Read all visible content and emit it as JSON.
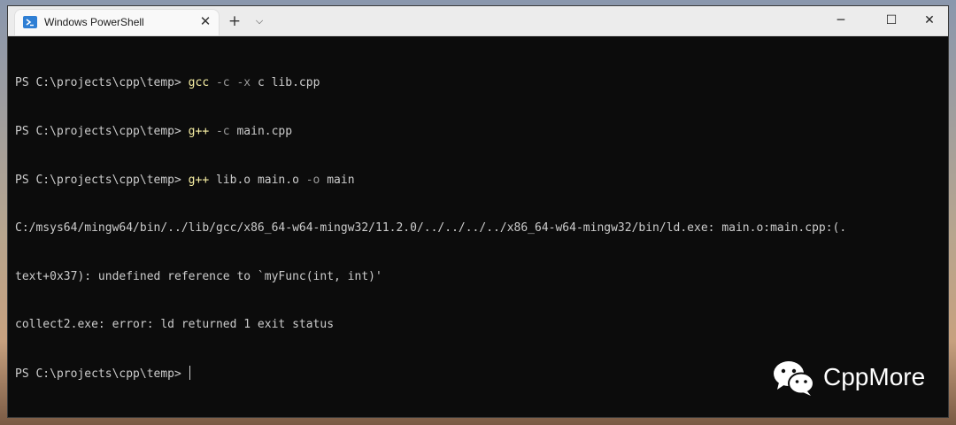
{
  "window": {
    "tab_title": "Windows PowerShell",
    "tab_close": "✕",
    "new_tab": "+",
    "dropdown": "⌵",
    "minimize": "─",
    "maximize": "☐",
    "close": "✕"
  },
  "terminal": {
    "line1": {
      "prompt": "PS C:\\projects\\cpp\\temp> ",
      "cmd": "gcc",
      "flags": " -c -x",
      "rest": " c lib.cpp"
    },
    "line2": {
      "prompt": "PS C:\\projects\\cpp\\temp> ",
      "cmd": "g++",
      "flags": " -c",
      "rest": " main.cpp"
    },
    "line3": {
      "prompt": "PS C:\\projects\\cpp\\temp> ",
      "cmd": "g++",
      "rest1": " lib.o main.o",
      "flags": " -o",
      "rest2": " main"
    },
    "line4": "C:/msys64/mingw64/bin/../lib/gcc/x86_64-w64-mingw32/11.2.0/../../../../x86_64-w64-mingw32/bin/ld.exe: main.o:main.cpp:(.",
    "line5": "text+0x37): undefined reference to `myFunc(int, int)'",
    "line6": "collect2.exe: error: ld returned 1 exit status",
    "line7": {
      "prompt": "PS C:\\projects\\cpp\\temp> "
    }
  },
  "watermark": {
    "text": "CppMore",
    "icon": "wechat-icon"
  },
  "colors": {
    "command": "#f9f1a5",
    "flag": "#9a9a9a",
    "text": "#cccccc",
    "background": "#0c0c0c"
  }
}
